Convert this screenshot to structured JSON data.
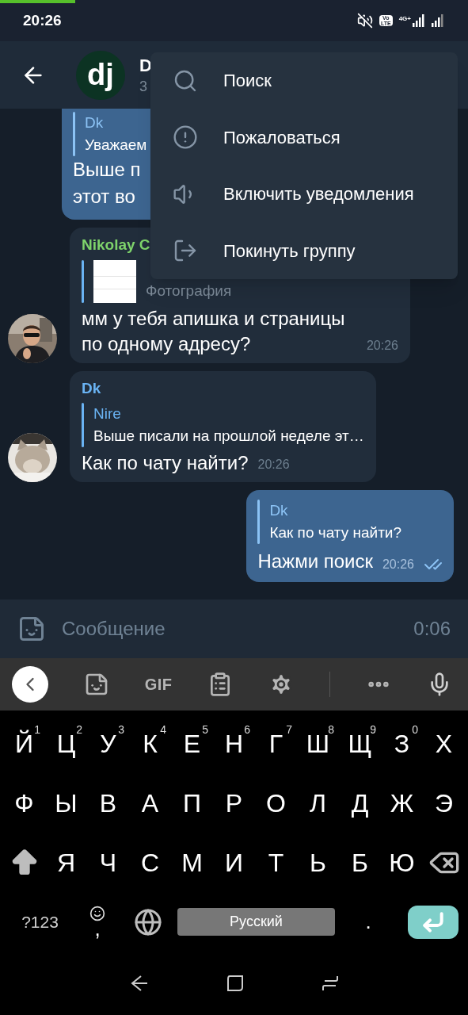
{
  "top_progress": {
    "level": 0.16
  },
  "status_bar": {
    "time": "20:26",
    "volte": [
      "Vo",
      "LTE"
    ],
    "network": "4G+"
  },
  "header": {
    "avatar_text": "dj",
    "title": "D",
    "subtitle": "3"
  },
  "messages": [
    {
      "kind": "outgoing",
      "reply": {
        "name": "Dk",
        "text": "Уважаем"
      },
      "lines": [
        "Выше п",
        "этот во"
      ]
    },
    {
      "kind": "incoming",
      "sender": {
        "name": "Nikolay C",
        "color": "#7ed36b"
      },
      "reply": {
        "thumbnail": true,
        "text": "Фотография"
      },
      "text": "мм у тебя апишка и страницы по одному адресу?",
      "time": "20:26"
    },
    {
      "kind": "incoming",
      "sender": {
        "name": "Dk",
        "color": "#6ab3f3"
      },
      "reply": {
        "name": "Nire",
        "text": "Выше писали на прошлой неделе эт…"
      },
      "text": "Как по чату найти?",
      "time": "20:26"
    },
    {
      "kind": "outgoing",
      "reply": {
        "name": "Dk",
        "text": "Как по чату найти?"
      },
      "text": "Нажми поиск",
      "time": "20:26",
      "read": true
    }
  ],
  "menu": [
    {
      "kind": "search",
      "label": "Поиск"
    },
    {
      "kind": "report",
      "label": "Пожаловаться"
    },
    {
      "kind": "unmute",
      "label": "Включить уведомления"
    },
    {
      "kind": "leave",
      "label": "Покинуть группу"
    }
  ],
  "composer": {
    "placeholder": "Сообщение",
    "timer": "0:06"
  },
  "keyboard": {
    "toolbar": [
      {
        "kind": "collapse"
      },
      {
        "kind": "sticker"
      },
      {
        "kind": "gif",
        "label": "GIF"
      },
      {
        "kind": "clipboard"
      },
      {
        "kind": "settings"
      },
      {
        "kind": "divider"
      },
      {
        "kind": "more"
      },
      {
        "kind": "mic"
      }
    ],
    "rows": [
      [
        {
          "kind": "letter",
          "label": "Й",
          "hint": "1"
        },
        {
          "kind": "letter",
          "label": "Ц",
          "hint": "2"
        },
        {
          "kind": "letter",
          "label": "У",
          "hint": "3"
        },
        {
          "kind": "letter",
          "label": "К",
          "hint": "4"
        },
        {
          "kind": "letter",
          "label": "Е",
          "hint": "5"
        },
        {
          "kind": "letter",
          "label": "Н",
          "hint": "6"
        },
        {
          "kind": "letter",
          "label": "Г",
          "hint": "7"
        },
        {
          "kind": "letter",
          "label": "Ш",
          "hint": "8"
        },
        {
          "kind": "letter",
          "label": "Щ",
          "hint": "9"
        },
        {
          "kind": "letter",
          "label": "З",
          "hint": "0"
        },
        {
          "kind": "letter",
          "label": "Х"
        }
      ],
      [
        {
          "kind": "letter",
          "label": "Ф"
        },
        {
          "kind": "letter",
          "label": "Ы"
        },
        {
          "kind": "letter",
          "label": "В"
        },
        {
          "kind": "letter",
          "label": "А"
        },
        {
          "kind": "letter",
          "label": "П"
        },
        {
          "kind": "letter",
          "label": "Р"
        },
        {
          "kind": "letter",
          "label": "О"
        },
        {
          "kind": "letter",
          "label": "Л"
        },
        {
          "kind": "letter",
          "label": "Д"
        },
        {
          "kind": "letter",
          "label": "Ж"
        },
        {
          "kind": "letter",
          "label": "Э"
        }
      ],
      [
        {
          "kind": "shift"
        },
        {
          "kind": "letter",
          "label": "Я"
        },
        {
          "kind": "letter",
          "label": "Ч"
        },
        {
          "kind": "letter",
          "label": "С"
        },
        {
          "kind": "letter",
          "label": "М"
        },
        {
          "kind": "letter",
          "label": "И"
        },
        {
          "kind": "letter",
          "label": "Т"
        },
        {
          "kind": "letter",
          "label": "Ь"
        },
        {
          "kind": "letter",
          "label": "Б"
        },
        {
          "kind": "letter",
          "label": "Ю"
        },
        {
          "kind": "backspace"
        }
      ]
    ],
    "bottom_row": [
      {
        "kind": "symbols",
        "label": "?123"
      },
      {
        "kind": "comma",
        "label": ","
      },
      {
        "kind": "globe"
      },
      {
        "kind": "space",
        "label": "Русский"
      },
      {
        "kind": "period",
        "label": "."
      },
      {
        "kind": "enter"
      }
    ]
  },
  "nav_bar": [
    {
      "kind": "back"
    },
    {
      "kind": "home"
    },
    {
      "kind": "recents"
    }
  ]
}
